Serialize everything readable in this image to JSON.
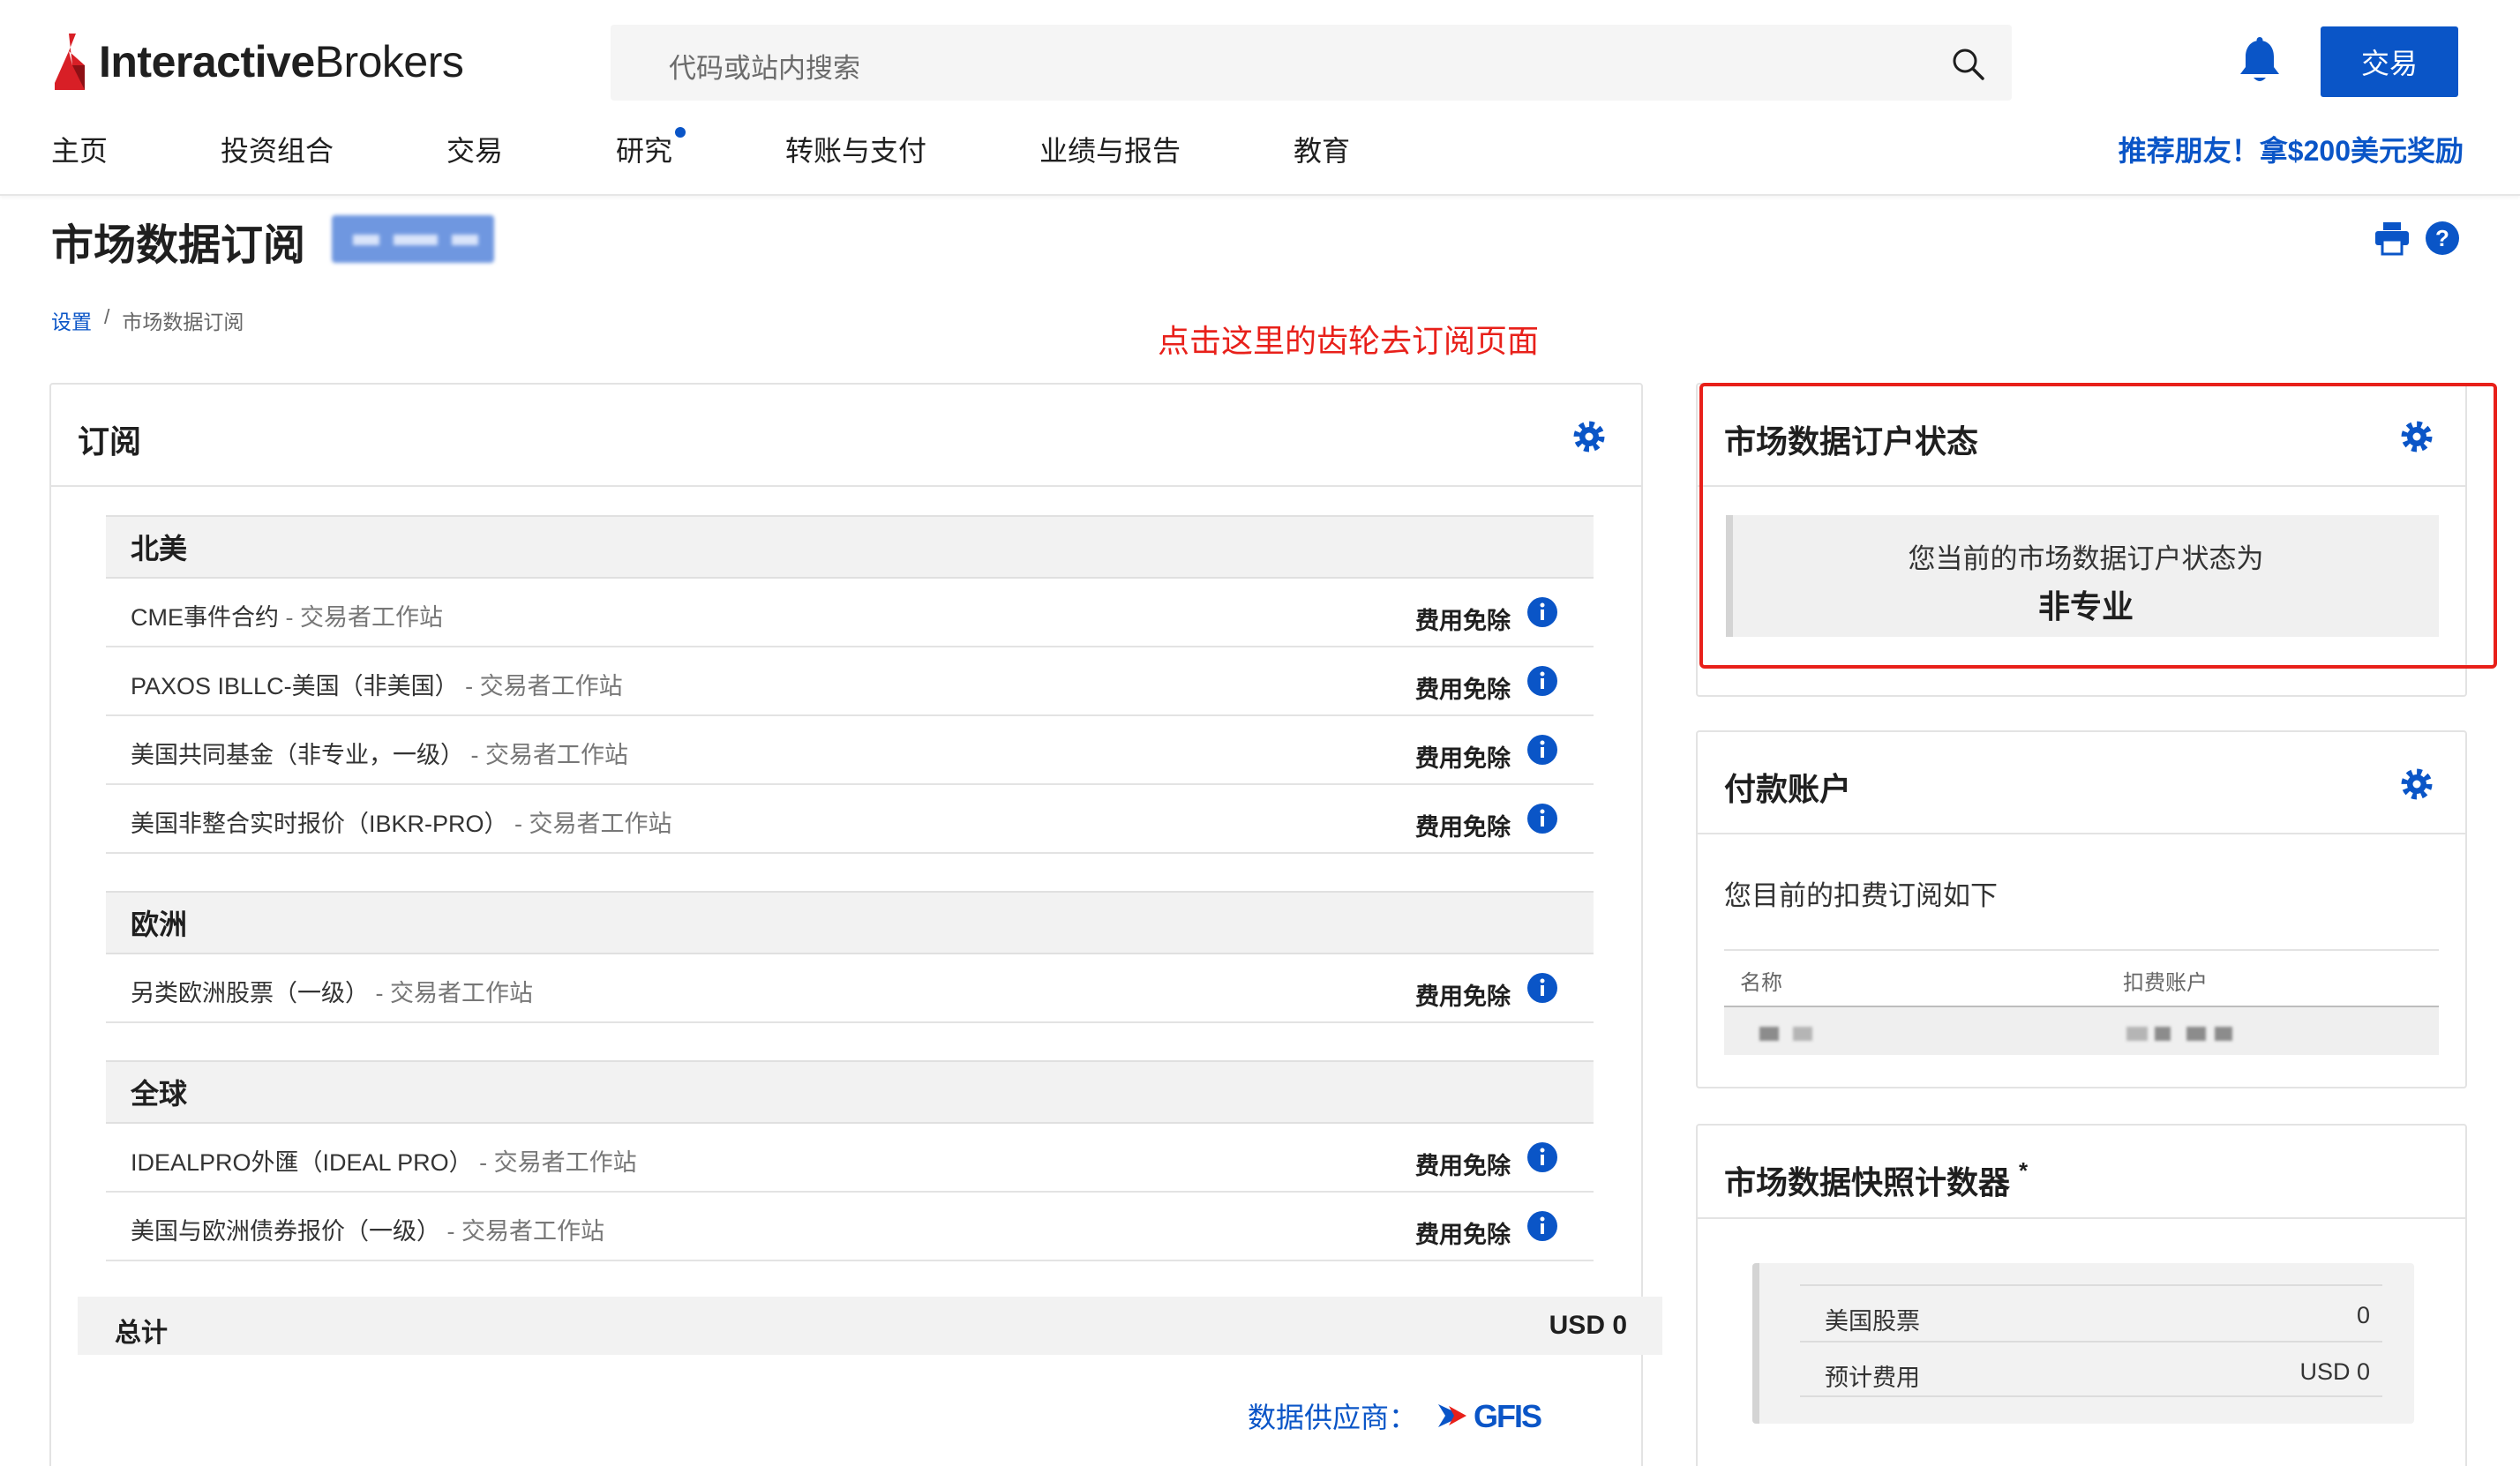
{
  "header": {
    "logo": {
      "bold": "Interactive",
      "regular": "Brokers"
    },
    "search_placeholder": "代码或站内搜索",
    "trade_button": "交易",
    "nav": [
      "主页",
      "投资组合",
      "交易",
      "研究",
      "转账与支付",
      "业绩与报告",
      "教育"
    ],
    "promo": "推荐朋友！拿$200美元奖励"
  },
  "page": {
    "title": "市场数据订阅",
    "breadcrumb": [
      "设置",
      "/",
      "市场数据订阅"
    ],
    "annotation": "点击这里的齿轮去订阅页面"
  },
  "subscriptions": {
    "title": "订阅",
    "fee_label": "费用免除",
    "regions": [
      {
        "name": "北美",
        "items": [
          {
            "name": "CME事件合约",
            "source": " - 交易者工作站"
          },
          {
            "name": "PAXOS IBLLC-美国（非美国）",
            "source": " - 交易者工作站"
          },
          {
            "name": "美国共同基金（非专业，一级）",
            "source": " - 交易者工作站"
          },
          {
            "name": "美国非整合实时报价（IBKR-PRO）",
            "source": " - 交易者工作站"
          }
        ]
      },
      {
        "name": "欧洲",
        "items": [
          {
            "name": "另类欧洲股票（一级）",
            "source": " - 交易者工作站"
          }
        ]
      },
      {
        "name": "全球",
        "items": [
          {
            "name": "IDEALPRO外匯（IDEAL PRO）",
            "source": " - 交易者工作站"
          },
          {
            "name": "美国与欧洲债券报价（一级）",
            "source": " - 交易者工作站"
          }
        ]
      }
    ],
    "total_label": "总计",
    "total_value": "USD 0",
    "provider_label": "数据供应商：",
    "provider_logo": "GFIS"
  },
  "status_panel": {
    "title": "市场数据订户状态",
    "line1": "您当前的市场数据订户状态为",
    "line2": "非专业"
  },
  "payment_panel": {
    "title": "付款账户",
    "description": "您目前的扣费订阅如下",
    "columns": [
      "名称",
      "扣费账户"
    ]
  },
  "snapshot_panel": {
    "title": "市场数据快照计数器",
    "title_mark": "*",
    "rows": [
      {
        "label": "美国股票",
        "value": "0"
      },
      {
        "label": "预计费用",
        "value": "USD 0"
      }
    ]
  },
  "colors": {
    "brand_blue": "#0a55c7",
    "annotation_red": "#e8201a",
    "logo_red": "#d81f26"
  }
}
